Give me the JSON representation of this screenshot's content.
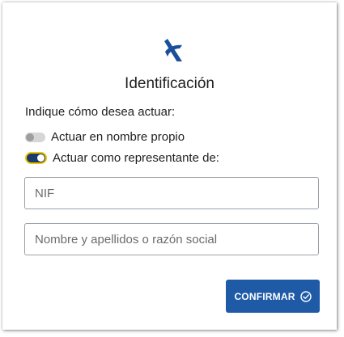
{
  "dialog": {
    "logo_icon": "agencia-tributaria-logo-icon",
    "title": "Identificación",
    "prompt": "Indique cómo desea actuar:"
  },
  "options": [
    {
      "label": "Actuar en nombre propio",
      "selected": false
    },
    {
      "label": "Actuar como representante de:",
      "selected": true
    }
  ],
  "fields": {
    "nif": {
      "value": "",
      "placeholder": "NIF"
    },
    "name": {
      "value": "",
      "placeholder": "Nombre y apellidos o razón social"
    }
  },
  "confirm": {
    "label": "CONFIRMAR",
    "icon": "check-circle-icon"
  },
  "colors": {
    "brand_blue": "#1f5aa6",
    "toggle_on": "#1a3c6b",
    "focus_ring": "#f2c200"
  }
}
